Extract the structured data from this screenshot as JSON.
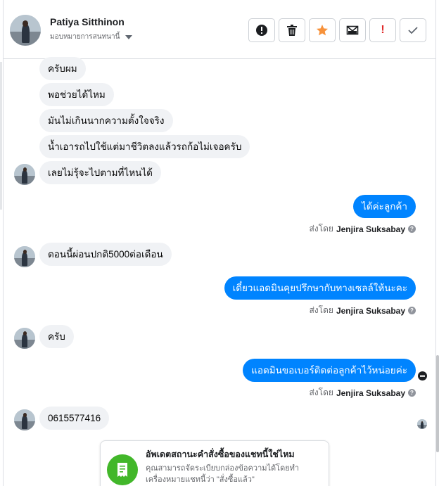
{
  "header": {
    "name": "Patiya Sitthinon",
    "assign_label": "มอบหมายการสนทนานี้",
    "tools": [
      {
        "icon": "alert-circle-icon",
        "label": "",
        "color": "#1c1e21"
      },
      {
        "icon": "trash-icon",
        "label": "",
        "color": "#1c1e21"
      },
      {
        "icon": "star-icon",
        "label": "",
        "color": "#f7923b"
      },
      {
        "icon": "envelope-icon",
        "label": "",
        "color": "#1c1e21"
      },
      {
        "icon": "spam-icon",
        "label": "!",
        "color": "#e02828"
      },
      {
        "icon": "check-icon",
        "label": "",
        "color": "#606770"
      }
    ]
  },
  "messages_in_top": [
    {
      "text": "ครับผม"
    },
    {
      "text": "พอช่วยได้ไหม"
    },
    {
      "text": "มันไม่เกินนากความตั้งใจจริง"
    },
    {
      "text": "น้ำเอารถไปใช้แต่มาชีวิตลงแล้วรถก้อไม่เจอครับ"
    },
    {
      "text": "เลยไม่รุ้จะไปตามที่ไหนได้"
    }
  ],
  "out_1": {
    "text": "ได้ค่ะลูกค้า"
  },
  "sent_by_1": {
    "prefix": "ส่งโดย",
    "agent": "Jenjira Suksabay"
  },
  "in_2": {
    "text": "ตอนนี้ผ่อนปกติ5000ต่อเดือน"
  },
  "out_2": {
    "text": "เดี๋ยวแอดมินคุยปรึกษากับทางเซลล์ให้นะคะ"
  },
  "sent_by_2": {
    "prefix": "ส่งโดย",
    "agent": "Jenjira Suksabay"
  },
  "in_3": {
    "text": "ครับ"
  },
  "out_3": {
    "text": "แอดมินขอเบอร์ติดต่อลูกค้าไว้หน่อยค่ะ"
  },
  "sent_by_3": {
    "prefix": "ส่งโดย",
    "agent": "Jenjira Suksabay"
  },
  "in_4": {
    "text": "0615577416"
  },
  "card": {
    "icon": "receipt-icon",
    "title": "อัพเดตสถานะคำสั่งซื้อของแชทนี้ใช่ไหม",
    "desc": "คุณสามารถจัดระเบียบกล่องข้อความได้โดยทำเครื่องหมายแชทนี้ว่า \"สั่งซื้อแล้ว\""
  },
  "colors": {
    "outgoing": "#0084ff",
    "incoming": "#f0f2f5",
    "accent_green": "#42b72a"
  }
}
